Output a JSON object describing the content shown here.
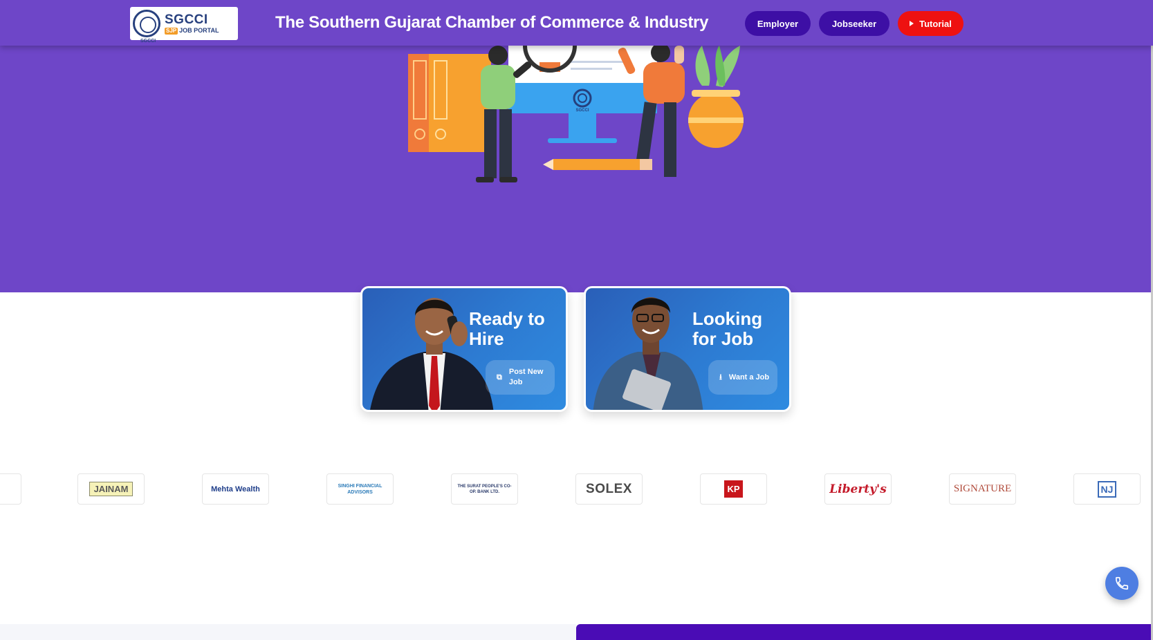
{
  "header": {
    "logo": {
      "seal_text": "SGCCI",
      "brand_top": "SGCCI",
      "brand_badge": "SJP",
      "brand_bottom": "JOB PORTAL"
    },
    "title": "The Southern Gujarat Chamber of Commerce & Industry",
    "nav": {
      "employer": "Employer",
      "jobseeker": "Jobseeker",
      "tutorial": "Tutorial"
    }
  },
  "hero": {
    "monitor_seal": "SGCCI"
  },
  "cards": {
    "hire": {
      "title": "Ready to Hire",
      "button": "Post New Job"
    },
    "job": {
      "title": "Looking for Job",
      "button": "Want a Job"
    }
  },
  "partners": [
    "JAINAM",
    "Mehta Wealth",
    "SINGHI FINANCIAL ADVISORS",
    "THE SURAT PEOPLE'S CO-OP. BANK LTD.",
    "SOLEX",
    "KP",
    "Liberty's",
    "SIGNATURE",
    "NJ"
  ],
  "colors": {
    "primary": "#6e46c8",
    "nav_button": "#3d0fa5",
    "tutorial": "#ee1111",
    "fab": "#4e7ee2"
  }
}
